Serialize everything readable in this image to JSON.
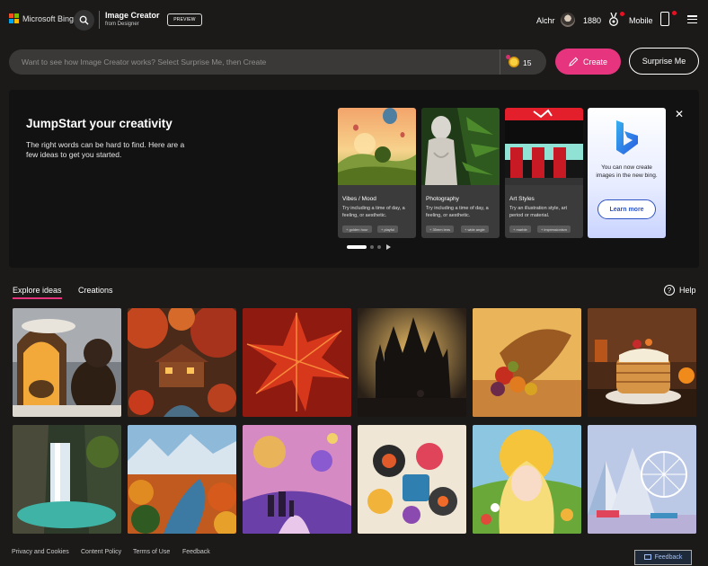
{
  "header": {
    "brand": "Microsoft Bing",
    "title": "Image Creator",
    "subtitle": "from Designer",
    "badge": "PREVIEW",
    "user_name": "Alchr",
    "points": "1880",
    "mobile": "Mobile"
  },
  "prompt": {
    "placeholder": "Want to see how Image Creator works? Select Surprise Me, then Create",
    "value": "",
    "boosts": "15",
    "create_label": "Create",
    "surprise_label": "Surprise Me"
  },
  "jumpstart": {
    "title": "JumpStart your creativity",
    "description": "The right words can be hard to find. Here are a few ideas to get you started.",
    "cards": [
      {
        "title": "Vibes / Mood",
        "text": "Try including a time of day, a feeling, or aesthetic.",
        "chips": [
          "golden hour",
          "playful"
        ]
      },
      {
        "title": "Photography",
        "text": "Try including a time of day, a feeling, or aesthetic.",
        "chips": [
          "35mm lens",
          "wide angle"
        ]
      },
      {
        "title": "Art Styles",
        "text": "Try an illustration style, art period or material.",
        "chips": [
          "marble",
          "impressionism"
        ]
      }
    ],
    "bing_card": {
      "text": "You can now create images in the new bing.",
      "button": "Learn more"
    }
  },
  "tabs": {
    "explore": "Explore ideas",
    "creations": "Creations",
    "help": "Help"
  },
  "footer": {
    "links": [
      "Privacy and Cookies",
      "Content Policy",
      "Terms of Use",
      "Feedback"
    ],
    "feedback_button": "Feedback"
  },
  "colors": {
    "accent": "#e6347f",
    "background": "#1b1a19",
    "panel": "#121212"
  },
  "gallery": [
    "bears-in-cozy-den",
    "autumn-cabin-by-stream",
    "red-maple-leaf",
    "dark-castle-with-rider",
    "autumn-cornucopia",
    "pancake-stack",
    "waterfall-canyon",
    "autumn-river-valley",
    "family-in-fantasy-world",
    "colorful-3d-shapes",
    "girl-with-flowers",
    "paper-art-ferris-wheel"
  ]
}
